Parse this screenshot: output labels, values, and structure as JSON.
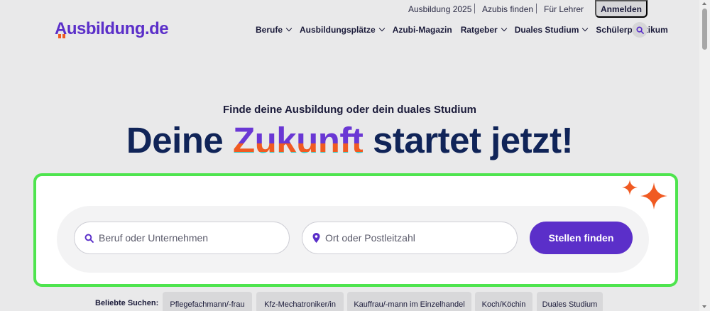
{
  "utility_links": [
    {
      "label": "Ausbildung 2025"
    },
    {
      "label": "Azubis finden"
    },
    {
      "label": "Für Lehrer"
    }
  ],
  "login_label": "Anmelden",
  "logo": {
    "text": "Ausbildung.de"
  },
  "nav": [
    {
      "label": "Berufe",
      "dropdown": true
    },
    {
      "label": "Ausbildungsplätze",
      "dropdown": true
    },
    {
      "label": "Azubi-Magazin",
      "dropdown": false
    },
    {
      "label": "Ratgeber",
      "dropdown": true
    },
    {
      "label": "Duales Studium",
      "dropdown": true
    },
    {
      "label": "Schülerpraktikum",
      "dropdown": false
    }
  ],
  "hero": {
    "subtitle": "Finde deine Ausbildung oder dein duales Studium",
    "headline_before": "Deine ",
    "headline_highlight": "Zukunft",
    "headline_after": " startet jetzt!"
  },
  "search": {
    "job_placeholder": "Beruf oder Unternehmen",
    "location_placeholder": "Ort oder Postleitzahl",
    "button_label": "Stellen finden"
  },
  "popular": {
    "label": "Beliebte Suchen:",
    "items": [
      {
        "label": "Pflegefachmann/-frau"
      },
      {
        "label": "Kfz-Mechatroniker/in"
      },
      {
        "label": "Kauffrau/-mann im Einzelhandel"
      },
      {
        "label": "Koch/Köchin"
      },
      {
        "label": "Duales Studium"
      }
    ]
  },
  "colors": {
    "brand_purple": "#5b2fc9",
    "accent_orange": "#f05a22",
    "accent_teal": "#39c9c0",
    "headline_navy": "#102458",
    "highlight_border": "#4ee44e"
  }
}
